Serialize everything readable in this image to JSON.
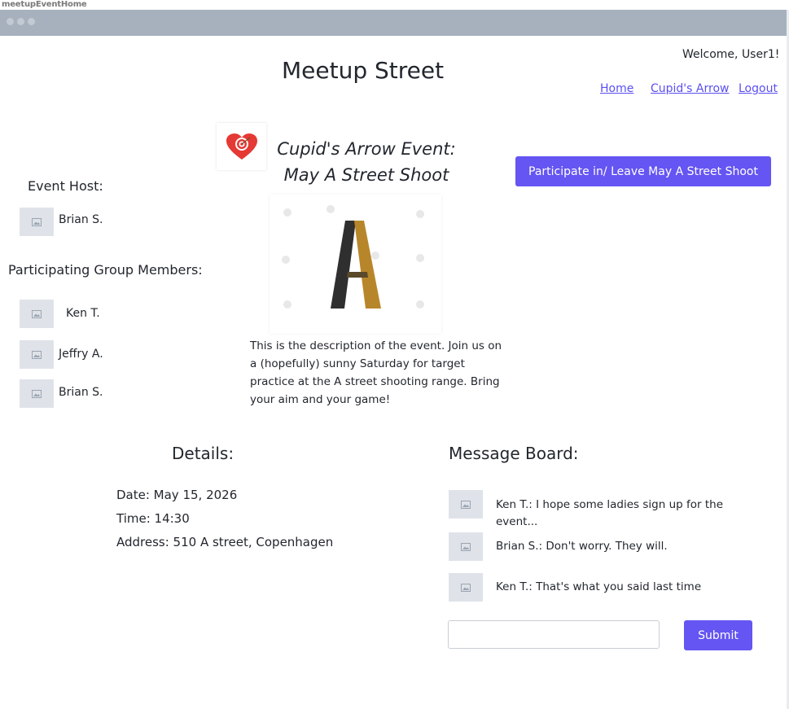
{
  "window": {
    "frame_label": "meetupEventHome"
  },
  "header": {
    "site_title": "Meetup Street",
    "welcome": "Welcome, User1!",
    "nav": {
      "home": "Home",
      "cupids_arrow": "Cupid's Arrow",
      "logout": "Logout"
    }
  },
  "event": {
    "title_line1": "Cupid's Arrow Event:",
    "title_line2": "May A Street Shoot",
    "action_button": "Participate in/ Leave May A Street Shoot",
    "logo_icon": "heart-target-icon",
    "image_icon": "letter-a-image",
    "description": "This is the description of the event. Join us on a (hopefully) sunny Saturday for target practice at the A street shooting range. Bring your aim and your game!"
  },
  "host": {
    "heading": "Event Host:",
    "name": "Brian S."
  },
  "participants": {
    "heading": "Participating Group Members:",
    "members": [
      "Ken T.",
      "Jeffry A.",
      "Brian S."
    ]
  },
  "details": {
    "heading": "Details:",
    "date": "Date: May 15, 2026",
    "time": "Time: 14:30",
    "address": "Address: 510 A street, Copenhagen"
  },
  "message_board": {
    "heading": "Message Board:",
    "messages": [
      "Ken T.: I hope some ladies sign up for the event...",
      "Brian S.: Don't worry. They will.",
      "Ken T.: That's what you said last time"
    ],
    "input_placeholder": "",
    "submit_label": "Submit"
  },
  "colors": {
    "accent": "#6555f2",
    "titlebar": "#a6b1bd",
    "avatar_bg": "#dfe3e9",
    "link": "#5b4ff0"
  }
}
